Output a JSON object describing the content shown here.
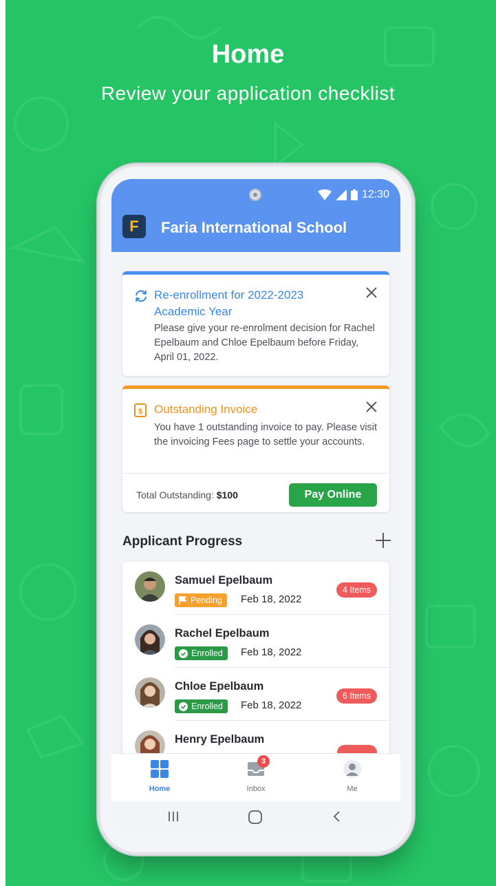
{
  "header": {
    "title": "Home",
    "subtitle": "Review your application checklist"
  },
  "status_bar": {
    "time": "12:30"
  },
  "app": {
    "logo_letter": "F",
    "school_name": "Faria International School"
  },
  "colors": {
    "background": "#25c465",
    "app_bar": "#5b93f1",
    "info_accent": "#3a86e6",
    "warning_accent": "#f0901c",
    "success": "#2aa449",
    "danger": "#ef5a5a"
  },
  "reenrollment_card": {
    "icon": "sync-icon",
    "title": "Re-enrollment for 2022-2023 Academic Year",
    "body": "Please give your re-enrolment decision for Rachel Epelbaum and Chloe Epelbaum before Friday, April 01, 2022."
  },
  "invoice_card": {
    "icon": "invoice-icon",
    "title": "Outstanding Invoice",
    "body": "You have 1 outstanding invoice to pay. Please visit the invoicing Fees page to settle your accounts.",
    "total_label": "Total Outstanding:",
    "total_value": "$100",
    "pay_label": "Pay Online"
  },
  "applicant_progress": {
    "title": "Applicant Progress",
    "applicants": [
      {
        "name": "Samuel Epelbaum",
        "status": "Pending",
        "date": "Feb 18, 2022",
        "items": "4 Items"
      },
      {
        "name": "Rachel Epelbaum",
        "status": "Enrolled",
        "date": "Feb 18, 2022",
        "items": ""
      },
      {
        "name": "Chloe Epelbaum",
        "status": "Enrolled",
        "date": "Feb 18, 2022",
        "items": "6 Items"
      },
      {
        "name": "Henry Epelbaum",
        "status": "",
        "date": "",
        "items": ""
      }
    ]
  },
  "bottom_nav": {
    "home": "Home",
    "inbox": "Inbox",
    "inbox_count": "3",
    "me": "Me"
  },
  "system_nav": {
    "icons": [
      "recents-icon",
      "home-circle-icon",
      "back-icon"
    ]
  }
}
